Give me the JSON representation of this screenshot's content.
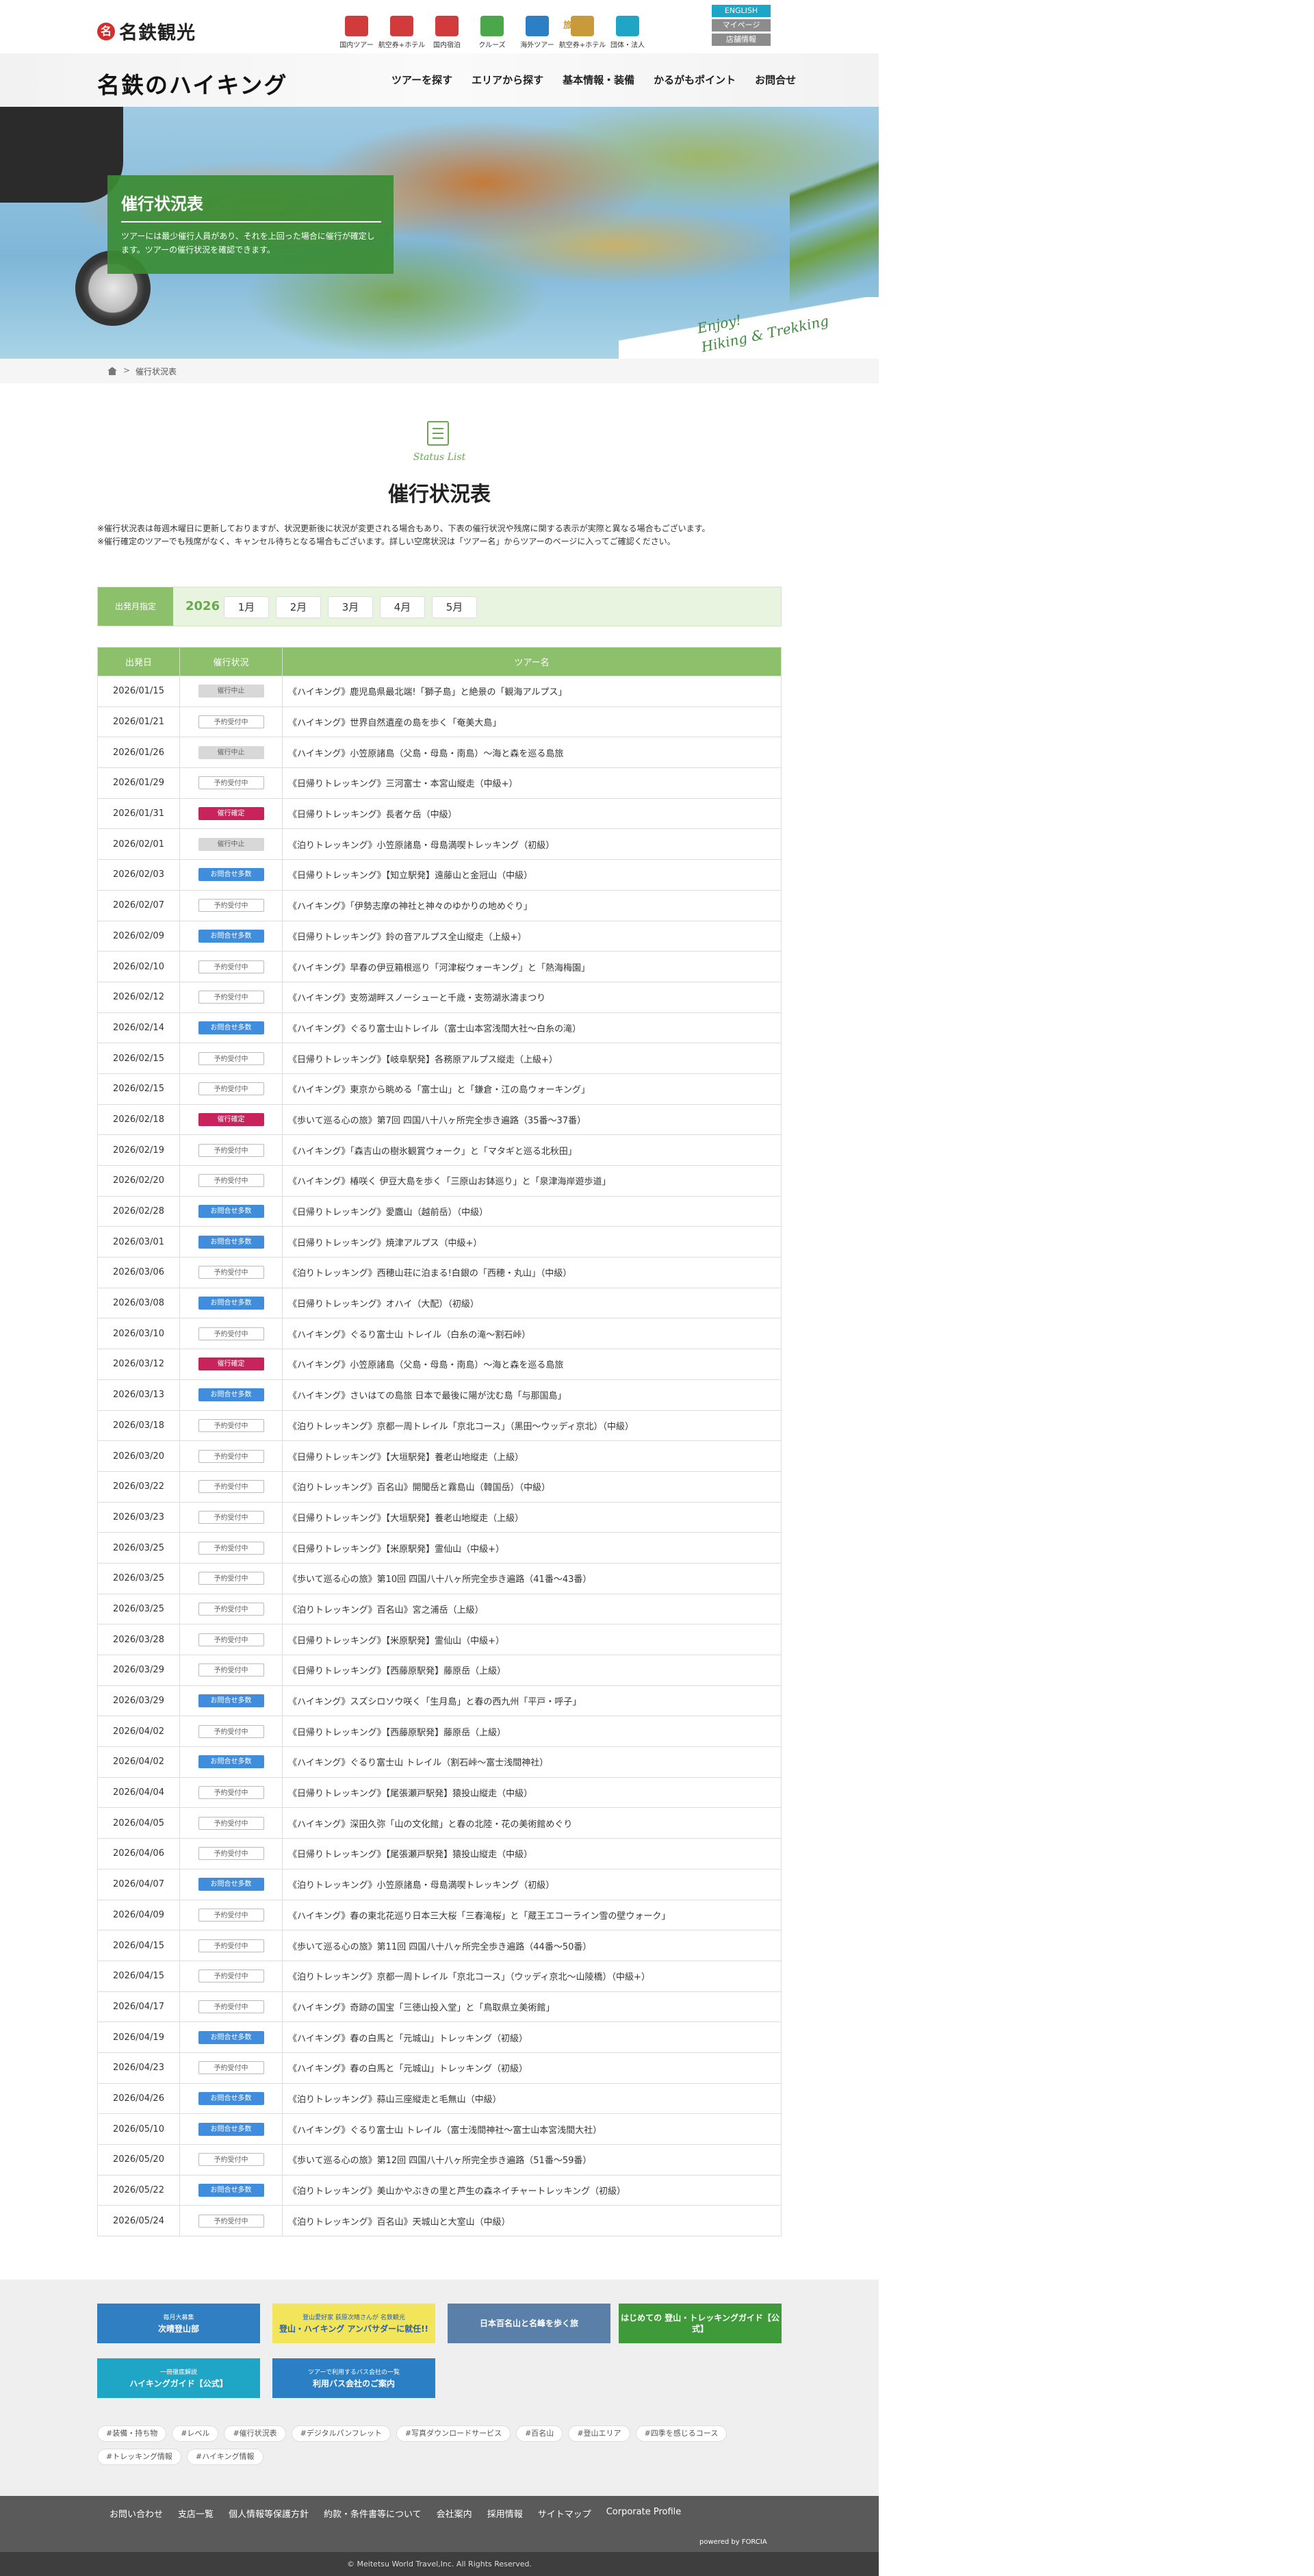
{
  "brand": "名鉄観光",
  "services": [
    {
      "label": "国内ツアー",
      "color": "#d23b3b"
    },
    {
      "label": "航空券+ホテル",
      "color": "#d23b3b"
    },
    {
      "label": "国内宿泊",
      "color": "#d23b3b"
    },
    {
      "label": "クルーズ",
      "color": "#4aa84a"
    },
    {
      "label": "海外ツアー",
      "color": "#2a7fc5"
    },
    {
      "label": "航空券+ホテル",
      "color": "#c89a3a"
    },
    {
      "label": "団体・法人",
      "color": "#1fa6c7"
    }
  ],
  "service_badge": "旅pad",
  "lang": {
    "english": "ENGLISH",
    "mypage": "マイページ",
    "shop": "店舗情報"
  },
  "logo": {
    "main": "名鉄のハイキング"
  },
  "menu": [
    "ツアーを探す",
    "エリアから探す",
    "基本情報・装備",
    "かるがもポイント",
    "お問合せ"
  ],
  "hero": {
    "title": "催行状況表",
    "desc": "ツアーには最少催行人員があり、それを上回った場合に催行が確定します。ツアーの催行状況を確認できます。",
    "enjoy1": "Enjoy!",
    "enjoy2": "Hiking & Trekking"
  },
  "breadcrumb": {
    "sep": ">",
    "current": "催行状況表"
  },
  "section": {
    "en": "Status List",
    "title": "催行状況表"
  },
  "notes": [
    "※催行状況表は毎週木曜日に更新しておりますが、状況更新後に状況が変更される場合もあり、下表の催行状況や残席に関する表示が実際と異なる場合もございます。",
    "※催行確定のツアーでも残席がなく、キャンセル待ちとなる場合もございます。詳しい空席状況は「ツアー名」からツアーのページに入ってご確認ください。"
  ],
  "month_select": {
    "label": "出発月指定",
    "year": "2026",
    "months": [
      "1月",
      "2月",
      "3月",
      "4月",
      "5月"
    ]
  },
  "table_headers": [
    "出発日",
    "催行状況",
    "ツアー名"
  ],
  "status_labels": {
    "r": "予約受付中",
    "c": "催行中止",
    "k": "催行確定",
    "a": "お問合せ多数"
  },
  "tours": [
    {
      "date": "2026/01/15",
      "status": "c",
      "name": "《ハイキング》鹿児島県最北端!「獅子島」と絶景の「観海アルプス」"
    },
    {
      "date": "2026/01/21",
      "status": "r",
      "name": "《ハイキング》世界自然遺産の島を歩く「奄美大島」"
    },
    {
      "date": "2026/01/26",
      "status": "c",
      "name": "《ハイキング》小笠原諸島（父島・母島・南島）〜海と森を巡る島旅"
    },
    {
      "date": "2026/01/29",
      "status": "r",
      "name": "《日帰りトレッキング》三河富士・本宮山縦走（中級+）"
    },
    {
      "date": "2026/01/31",
      "status": "k",
      "name": "《日帰りトレッキング》長者ケ岳（中級）"
    },
    {
      "date": "2026/02/01",
      "status": "c",
      "name": "《泊りトレッキング》小笠原諸島・母島満喫トレッキング（初級）"
    },
    {
      "date": "2026/02/03",
      "status": "a",
      "name": "《日帰りトレッキング》【知立駅発】遠藤山と金冠山（中級）"
    },
    {
      "date": "2026/02/07",
      "status": "r",
      "name": "《ハイキング》「伊勢志摩の神社と神々のゆかりの地めぐり」"
    },
    {
      "date": "2026/02/09",
      "status": "a",
      "name": "《日帰りトレッキング》鈴の音アルプス全山縦走（上級+）"
    },
    {
      "date": "2026/02/10",
      "status": "r",
      "name": "《ハイキング》早春の伊豆箱根巡り「河津桜ウォーキング」と「熱海梅園」"
    },
    {
      "date": "2026/02/12",
      "status": "r",
      "name": "《ハイキング》支笏湖畔スノーシューと千歳・支笏湖氷濤まつり"
    },
    {
      "date": "2026/02/14",
      "status": "a",
      "name": "《ハイキング》ぐるり富士山トレイル（富士山本宮浅間大社〜白糸の滝）"
    },
    {
      "date": "2026/02/15",
      "status": "r",
      "name": "《日帰りトレッキング》【岐阜駅発】各務原アルプス縦走（上級+）"
    },
    {
      "date": "2026/02/15",
      "status": "r",
      "name": "《ハイキング》東京から眺める「富士山」と「鎌倉・江の島ウォーキング」"
    },
    {
      "date": "2026/02/18",
      "status": "k",
      "name": "《歩いて巡る心の旅》第7回 四国八十八ヶ所完全歩き遍路（35番〜37番）"
    },
    {
      "date": "2026/02/19",
      "status": "r",
      "name": "《ハイキング》「森吉山の樹氷観賞ウォーク」と「マタギと巡る北秋田」"
    },
    {
      "date": "2026/02/20",
      "status": "r",
      "name": "《ハイキング》椿咲く 伊豆大島を歩く「三原山お鉢巡り」と「泉津海岸遊歩道」"
    },
    {
      "date": "2026/02/28",
      "status": "a",
      "name": "《日帰りトレッキング》愛鷹山（越前岳）（中級）"
    },
    {
      "date": "2026/03/01",
      "status": "a",
      "name": "《日帰りトレッキング》焼津アルプス（中級+）"
    },
    {
      "date": "2026/03/06",
      "status": "r",
      "name": "《泊りトレッキング》西穂山荘に泊まる!白銀の「西穂・丸山」（中級）"
    },
    {
      "date": "2026/03/08",
      "status": "a",
      "name": "《日帰りトレッキング》オハイ（大配）（初級）"
    },
    {
      "date": "2026/03/10",
      "status": "r",
      "name": "《ハイキング》ぐるり富士山 トレイル（白糸の滝〜割石峠）"
    },
    {
      "date": "2026/03/12",
      "status": "k",
      "name": "《ハイキング》小笠原諸島（父島・母島・南島）〜海と森を巡る島旅"
    },
    {
      "date": "2026/03/13",
      "status": "a",
      "name": "《ハイキング》さいはての島旅 日本で最後に陽が沈む島「与那国島」"
    },
    {
      "date": "2026/03/18",
      "status": "r",
      "name": "《泊りトレッキング》京都一周トレイル「京北コース」（黒田〜ウッディ京北）（中級）"
    },
    {
      "date": "2026/03/20",
      "status": "r",
      "name": "《日帰りトレッキング》【大垣駅発】養老山地縦走（上級）"
    },
    {
      "date": "2026/03/22",
      "status": "r",
      "name": "《泊りトレッキング》百名山》開聞岳と霧島山（韓国岳）（中級）"
    },
    {
      "date": "2026/03/23",
      "status": "r",
      "name": "《日帰りトレッキング》【大垣駅発】養老山地縦走（上級）"
    },
    {
      "date": "2026/03/25",
      "status": "r",
      "name": "《日帰りトレッキング》【米原駅発】霊仙山（中級+）"
    },
    {
      "date": "2026/03/25",
      "status": "r",
      "name": "《歩いて巡る心の旅》第10回 四国八十八ヶ所完全歩き遍路（41番〜43番）"
    },
    {
      "date": "2026/03/25",
      "status": "r",
      "name": "《泊りトレッキング》百名山》宮之浦岳（上級）"
    },
    {
      "date": "2026/03/28",
      "status": "r",
      "name": "《日帰りトレッキング》【米原駅発】霊仙山（中級+）"
    },
    {
      "date": "2026/03/29",
      "status": "r",
      "name": "《日帰りトレッキング》【西藤原駅発】藤原岳（上級）"
    },
    {
      "date": "2026/03/29",
      "status": "a",
      "name": "《ハイキング》スズシロソウ咲く「生月島」と春の西九州「平戸・呼子」"
    },
    {
      "date": "2026/04/02",
      "status": "r",
      "name": "《日帰りトレッキング》【西藤原駅発】藤原岳（上級）"
    },
    {
      "date": "2026/04/02",
      "status": "a",
      "name": "《ハイキング》ぐるり富士山 トレイル（割石峠〜富士浅間神社）"
    },
    {
      "date": "2026/04/04",
      "status": "r",
      "name": "《日帰りトレッキング》【尾張瀬戸駅発】猿投山縦走（中級）"
    },
    {
      "date": "2026/04/05",
      "status": "r",
      "name": "《ハイキング》深田久弥「山の文化館」と春の北陸・花の美術館めぐり"
    },
    {
      "date": "2026/04/06",
      "status": "r",
      "name": "《日帰りトレッキング》【尾張瀬戸駅発】猿投山縦走（中級）"
    },
    {
      "date": "2026/04/07",
      "status": "a",
      "name": "《泊りトレッキング》小笠原諸島・母島満喫トレッキング（初級）"
    },
    {
      "date": "2026/04/09",
      "status": "r",
      "name": "《ハイキング》春の東北花巡り日本三大桜「三春滝桜」と「蔵王エコーライン雪の壁ウォーク」"
    },
    {
      "date": "2026/04/15",
      "status": "r",
      "name": "《歩いて巡る心の旅》第11回 四国八十八ヶ所完全歩き遍路（44番〜50番）"
    },
    {
      "date": "2026/04/15",
      "status": "r",
      "name": "《泊りトレッキング》京都一周トレイル「京北コース」（ウッディ京北〜山陵橋）（中級+）"
    },
    {
      "date": "2026/04/17",
      "status": "r",
      "name": "《ハイキング》奇跡の国宝「三徳山投入堂」と「鳥取県立美術館」"
    },
    {
      "date": "2026/04/19",
      "status": "a",
      "name": "《ハイキング》春の白馬と「元城山」トレッキング（初級）"
    },
    {
      "date": "2026/04/23",
      "status": "r",
      "name": "《ハイキング》春の白馬と「元城山」トレッキング（初級）"
    },
    {
      "date": "2026/04/26",
      "status": "a",
      "name": "《泊りトレッキング》蒜山三座縦走と毛無山（中級）"
    },
    {
      "date": "2026/05/10",
      "status": "a",
      "name": "《ハイキング》ぐるり富士山 トレイル（富士浅間神社〜富士山本宮浅間大社）"
    },
    {
      "date": "2026/05/20",
      "status": "r",
      "name": "《歩いて巡る心の旅》第12回 四国八十八ヶ所完全歩き遍路（51番〜59番）"
    },
    {
      "date": "2026/05/22",
      "status": "a",
      "name": "《泊りトレッキング》美山かやぶきの里と芦生の森ネイチャートレッキング（初級）"
    },
    {
      "date": "2026/05/24",
      "status": "r",
      "name": "《泊りトレッキング》百名山》天城山と大室山（中級）"
    }
  ],
  "banners": [
    {
      "text": "次晴登山部",
      "sub": "毎月大募集",
      "bg": "#2f7fc2",
      "fg": "#fff"
    },
    {
      "text": "登山・ハイキング アンバサダーに就任!!",
      "sub": "登山愛好家 荻原次晴さんが 名鉄観光",
      "bg": "#f2e55a",
      "fg": "#2a5fa8"
    },
    {
      "text": "日本百名山と名峰を歩く旅",
      "sub": "",
      "bg": "#5a7fa8",
      "fg": "#fff"
    },
    {
      "text": "はじめての 登山・トレッキングガイド【公式】",
      "sub": "",
      "bg": "#3f9b3a",
      "fg": "#fff"
    },
    {
      "text": "ハイキングガイド【公式】",
      "sub": "一冊徹底解説",
      "bg": "#1fa6c7",
      "fg": "#fff"
    },
    {
      "text": "利用バス会社のご案内",
      "sub": "ツアーで利用するバス会社の一覧",
      "bg": "#2a7fc5",
      "fg": "#fff"
    }
  ],
  "tags": [
    "#装備・持ち物",
    "#レベル",
    "#催行状況表",
    "#デジタルパンフレット",
    "#写真ダウンロードサービス",
    "#百名山",
    "#登山エリア",
    "#四季を感じるコース",
    "#トレッキング情報",
    "#ハイキング情報"
  ],
  "footer_links": [
    "お問い合わせ",
    "支店一覧",
    "個人情報等保護方針",
    "約款・条件書等について",
    "会社案内",
    "採用情報",
    "サイトマップ",
    "Corporate Profile"
  ],
  "powered": "powered by FORCIA",
  "copyright": "© Meitetsu World Travel,Inc. All Rights Reserved."
}
